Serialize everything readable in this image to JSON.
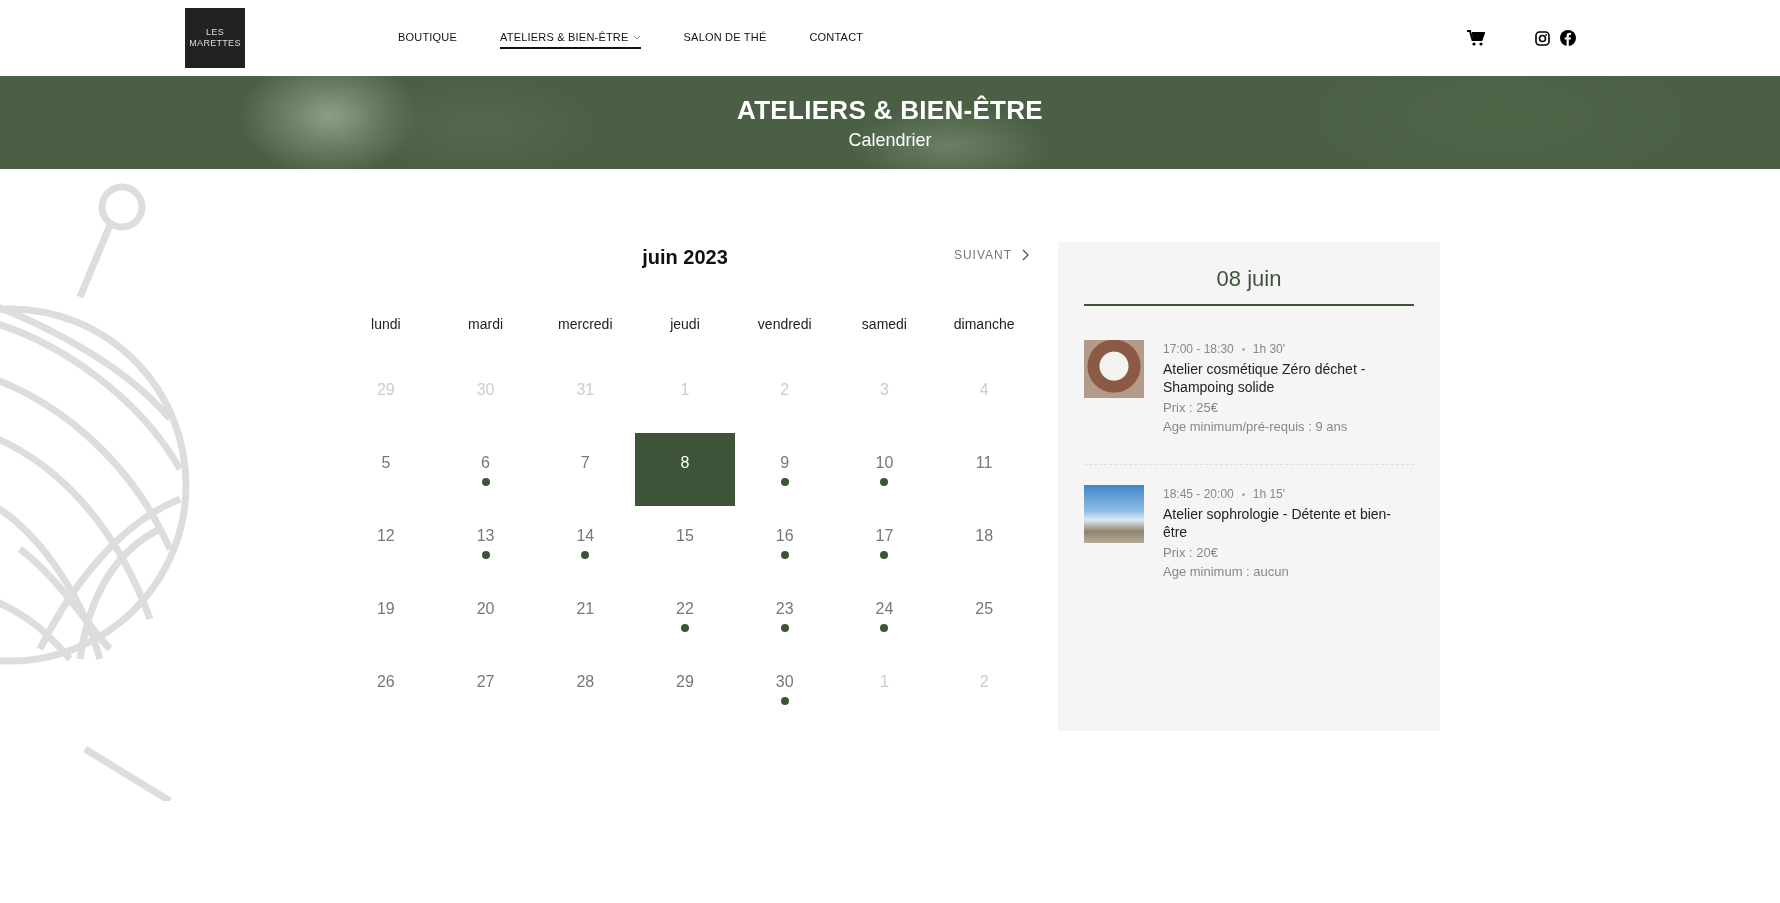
{
  "header": {
    "logo": [
      "LES",
      "MARETTES"
    ],
    "nav": [
      {
        "label": "BOUTIQUE",
        "selected": false,
        "dropdown": false
      },
      {
        "label": "ATELIERS & BIEN-ÊTRE",
        "selected": true,
        "dropdown": true
      },
      {
        "label": "SALON DE THÉ",
        "selected": false,
        "dropdown": false
      },
      {
        "label": "CONTACT",
        "selected": false,
        "dropdown": false
      }
    ]
  },
  "banner": {
    "title": "ATELIERS & BIEN-ÊTRE",
    "subtitle": "Calendrier"
  },
  "calendar": {
    "month": "juin 2023",
    "next": "SUIVANT",
    "weekdays": [
      "lundi",
      "mardi",
      "mercredi",
      "jeudi",
      "vendredi",
      "samedi",
      "dimanche"
    ],
    "weeks": [
      [
        {
          "day": "29",
          "outside": true,
          "has_event": false,
          "selected": false
        },
        {
          "day": "30",
          "outside": true,
          "has_event": false,
          "selected": false
        },
        {
          "day": "31",
          "outside": true,
          "has_event": false,
          "selected": false
        },
        {
          "day": "1",
          "outside": true,
          "has_event": false,
          "selected": false
        },
        {
          "day": "2",
          "outside": true,
          "has_event": false,
          "selected": false
        },
        {
          "day": "3",
          "outside": true,
          "has_event": false,
          "selected": false
        },
        {
          "day": "4",
          "outside": true,
          "has_event": false,
          "selected": false
        }
      ],
      [
        {
          "day": "5",
          "outside": false,
          "has_event": false,
          "selected": false
        },
        {
          "day": "6",
          "outside": false,
          "has_event": true,
          "selected": false
        },
        {
          "day": "7",
          "outside": false,
          "has_event": false,
          "selected": false
        },
        {
          "day": "8",
          "outside": false,
          "has_event": false,
          "selected": true
        },
        {
          "day": "9",
          "outside": false,
          "has_event": true,
          "selected": false
        },
        {
          "day": "10",
          "outside": false,
          "has_event": true,
          "selected": false
        },
        {
          "day": "11",
          "outside": false,
          "has_event": false,
          "selected": false
        }
      ],
      [
        {
          "day": "12",
          "outside": false,
          "has_event": false,
          "selected": false
        },
        {
          "day": "13",
          "outside": false,
          "has_event": true,
          "selected": false
        },
        {
          "day": "14",
          "outside": false,
          "has_event": true,
          "selected": false
        },
        {
          "day": "15",
          "outside": false,
          "has_event": false,
          "selected": false
        },
        {
          "day": "16",
          "outside": false,
          "has_event": true,
          "selected": false
        },
        {
          "day": "17",
          "outside": false,
          "has_event": true,
          "selected": false
        },
        {
          "day": "18",
          "outside": false,
          "has_event": false,
          "selected": false
        }
      ],
      [
        {
          "day": "19",
          "outside": false,
          "has_event": false,
          "selected": false
        },
        {
          "day": "20",
          "outside": false,
          "has_event": false,
          "selected": false
        },
        {
          "day": "21",
          "outside": false,
          "has_event": false,
          "selected": false
        },
        {
          "day": "22",
          "outside": false,
          "has_event": true,
          "selected": false
        },
        {
          "day": "23",
          "outside": false,
          "has_event": true,
          "selected": false
        },
        {
          "day": "24",
          "outside": false,
          "has_event": true,
          "selected": false
        },
        {
          "day": "25",
          "outside": false,
          "has_event": false,
          "selected": false
        }
      ],
      [
        {
          "day": "26",
          "outside": false,
          "has_event": false,
          "selected": false
        },
        {
          "day": "27",
          "outside": false,
          "has_event": false,
          "selected": false
        },
        {
          "day": "28",
          "outside": false,
          "has_event": false,
          "selected": false
        },
        {
          "day": "29",
          "outside": false,
          "has_event": false,
          "selected": false
        },
        {
          "day": "30",
          "outside": false,
          "has_event": true,
          "selected": false
        },
        {
          "day": "1",
          "outside": true,
          "has_event": false,
          "selected": false
        },
        {
          "day": "2",
          "outside": true,
          "has_event": false,
          "selected": false
        }
      ]
    ]
  },
  "day_panel": {
    "title": "08 juin",
    "events": [
      {
        "time": "17:00 - 18:30",
        "duration": "1h 30'",
        "title": "Atelier cosmétique Zéro déchet - Shampoing solide",
        "price": "Prix : 25€",
        "age": "Age minimum/pré-requis : 9 ans"
      },
      {
        "time": "18:45 - 20:00",
        "duration": "1h 15'",
        "title": "Atelier sophrologie - Détente et bien-être",
        "price": "Prix : 20€",
        "age": "Age minimum : aucun"
      }
    ]
  }
}
